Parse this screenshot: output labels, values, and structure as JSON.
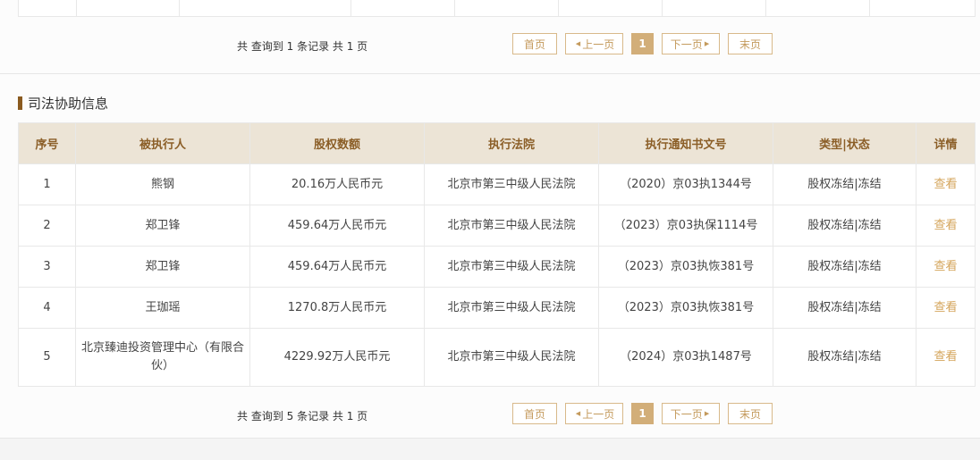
{
  "top_pager": {
    "summary": "共 查询到 1 条记录 共 1 页",
    "first": "首页",
    "prev": "上一页",
    "current": "1",
    "next": "下一页",
    "last": "末页"
  },
  "section": {
    "title": "司法协助信息"
  },
  "table": {
    "headers": [
      "序号",
      "被执行人",
      "股权数额",
      "执行法院",
      "执行通知书文号",
      "类型|状态",
      "详情"
    ],
    "rows": [
      {
        "index": "1",
        "person": "熊钢",
        "amount": "20.16万人民币元",
        "court": "北京市第三中级人民法院",
        "doc_no": "（2020）京03执1344号",
        "status": "股权冻结|冻结",
        "detail": "查看"
      },
      {
        "index": "2",
        "person": "郑卫锋",
        "amount": "459.64万人民币元",
        "court": "北京市第三中级人民法院",
        "doc_no": "（2023）京03执保1114号",
        "status": "股权冻结|冻结",
        "detail": "查看"
      },
      {
        "index": "3",
        "person": "郑卫锋",
        "amount": "459.64万人民币元",
        "court": "北京市第三中级人民法院",
        "doc_no": "（2023）京03执恢381号",
        "status": "股权冻结|冻结",
        "detail": "查看"
      },
      {
        "index": "4",
        "person": "王珈瑶",
        "amount": "1270.8万人民币元",
        "court": "北京市第三中级人民法院",
        "doc_no": "（2023）京03执恢381号",
        "status": "股权冻结|冻结",
        "detail": "查看"
      },
      {
        "index": "5",
        "person": "北京臻迪投资管理中心（有限合伙）",
        "amount": "4229.92万人民币元",
        "court": "北京市第三中级人民法院",
        "doc_no": "（2024）京03执1487号",
        "status": "股权冻结|冻结",
        "detail": "查看"
      }
    ]
  },
  "bottom_pager": {
    "summary": "共 查询到 5 条记录 共 1 页",
    "first": "首页",
    "prev": "上一页",
    "current": "1",
    "next": "下一页",
    "last": "末页"
  },
  "colors": {
    "accent": "#d2ae79",
    "header_bg": "#ece4d6",
    "header_text": "#8b5e27",
    "link": "#d4a45a",
    "section_bar": "#8a5a1f"
  }
}
